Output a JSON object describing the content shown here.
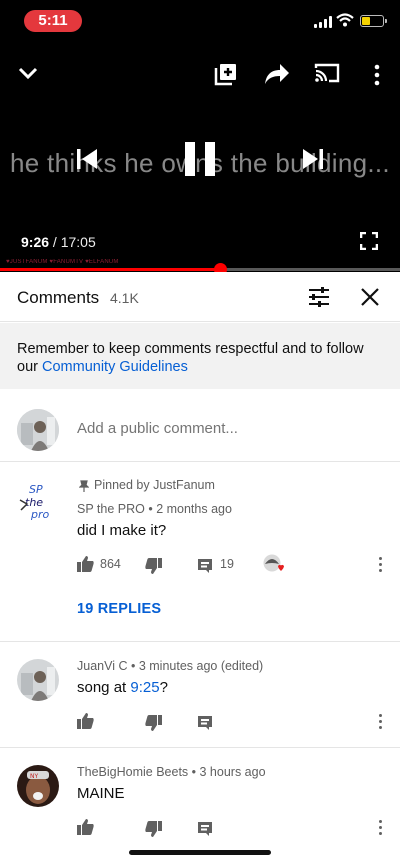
{
  "status_bar": {
    "time": "5:11"
  },
  "player": {
    "overlay_text": "he thinks he owns the building...",
    "current_time": "9:26",
    "duration": "17:05",
    "separator": " / ",
    "progress": 0.551,
    "watermark": "♥JUSTFANUM  ♥FANUMTV  ♥ELFANUM"
  },
  "comments_panel": {
    "title": "Comments",
    "count": "4.1K",
    "guidelines_text": "Remember to keep comments respectful and to follow our ",
    "guidelines_link": "Community Guidelines",
    "add_placeholder": "Add a public comment..."
  },
  "comments": [
    {
      "pinned_label": "Pinned by JustFanum",
      "author": "SP the PRO",
      "time": "2 months ago",
      "text": "did I make it?",
      "likes": "864",
      "reply_count": "19",
      "replies_label": "19 REPLIES"
    },
    {
      "author": "JuanVi C",
      "time": "3 minutes ago (edited)",
      "text_prefix": "song at ",
      "timestamp_link": "9:25",
      "text_suffix": "?"
    },
    {
      "author": "TheBigHomie Beets",
      "time": "3 hours ago",
      "text": "MAINE"
    }
  ],
  "colors": {
    "accent_blue": "#065fd4",
    "progress_red": "#ff0000",
    "time_pill": "#e4383d"
  }
}
